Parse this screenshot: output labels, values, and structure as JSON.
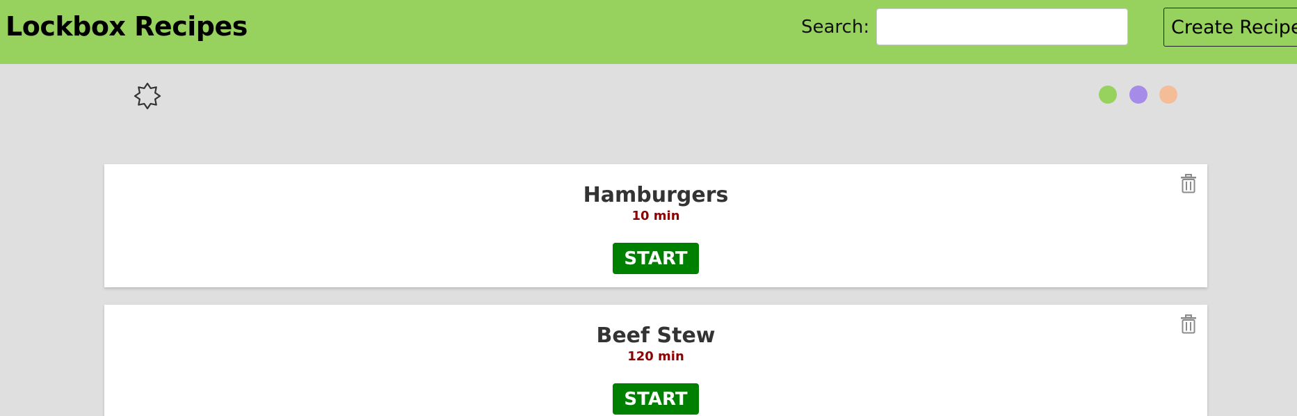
{
  "header": {
    "title": "Lockbox Recipes",
    "search_label": "Search:",
    "search_value": "",
    "search_placeholder": "",
    "create_button_label": "Create Recipe"
  },
  "toolbar": {
    "theme_toggle_icon": "day-night-toggle-icon",
    "color_swatches": [
      {
        "name": "green",
        "color": "#97d25e"
      },
      {
        "name": "purple",
        "color": "#a78be8"
      },
      {
        "name": "peach",
        "color": "#f5bc98"
      }
    ]
  },
  "recipes": [
    {
      "name": "Hamburgers",
      "time": "10 min",
      "start_label": "START",
      "delete_icon": "trash-icon"
    },
    {
      "name": "Beef Stew",
      "time": "120 min",
      "start_label": "START",
      "delete_icon": "trash-icon"
    }
  ],
  "colors": {
    "header_bg": "#97d25e",
    "page_bg": "#dfdfdf",
    "start_button": "#008000",
    "time_text": "#8b0000"
  }
}
